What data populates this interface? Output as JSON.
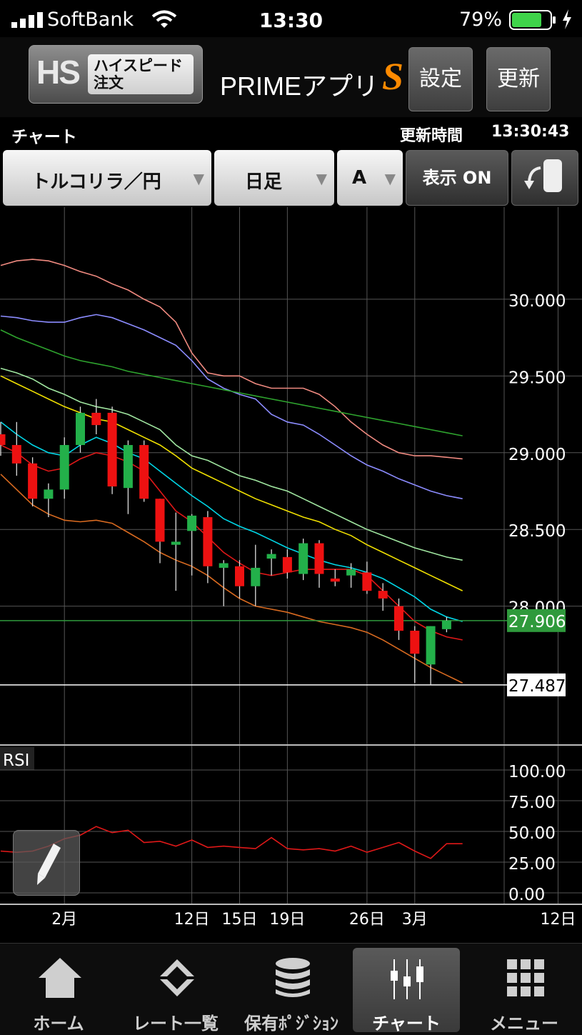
{
  "status_bar": {
    "carrier": "SoftBank",
    "time": "13:30",
    "battery_percent": "79%",
    "battery_level": 0.79
  },
  "header": {
    "hs_logo": "HS",
    "hs_label_line1": "ハイスピード",
    "hs_label_line2": "注文",
    "app_title": "PRIMEアプリ",
    "app_title_s": "S",
    "settings_label": "設定",
    "refresh_label": "更新"
  },
  "info": {
    "title": "チャート",
    "updated_label": "更新時間",
    "updated_time": "13:30:43"
  },
  "selectors": {
    "pair": "トルコリラ／円",
    "timeframe": "日足",
    "mode": "A",
    "display_toggle": "表示 ON"
  },
  "chart_data": {
    "type": "candlestick",
    "symbol": "トルコリラ／円",
    "y_ticks": [
      "30.000",
      "29.500",
      "29.000",
      "28.500",
      "28.000"
    ],
    "y_ticks_values": [
      30.0,
      29.5,
      29.0,
      28.5,
      28.0
    ],
    "ylim": [
      27.1,
      30.6
    ],
    "current_price": "27.906",
    "current_price_value": 27.906,
    "low_marker": "27.487",
    "low_marker_value": 27.487,
    "x_labels": [
      "2月",
      "12日",
      "15日",
      "19日",
      "26日",
      "3月",
      "12日"
    ],
    "x_label_index": [
      4,
      12,
      15,
      18,
      23,
      26,
      35
    ],
    "candles": [
      {
        "o": 29.12,
        "h": 29.2,
        "l": 28.98,
        "c": 29.05
      },
      {
        "o": 29.05,
        "h": 29.2,
        "l": 28.85,
        "c": 28.93
      },
      {
        "o": 28.93,
        "h": 28.97,
        "l": 28.65,
        "c": 28.7
      },
      {
        "o": 28.7,
        "h": 28.8,
        "l": 28.58,
        "c": 28.76
      },
      {
        "o": 28.76,
        "h": 29.1,
        "l": 28.7,
        "c": 29.05
      },
      {
        "o": 29.05,
        "h": 29.3,
        "l": 29.0,
        "c": 29.26
      },
      {
        "o": 29.26,
        "h": 29.35,
        "l": 29.12,
        "c": 29.18
      },
      {
        "o": 29.26,
        "h": 29.3,
        "l": 28.73,
        "c": 28.78
      },
      {
        "o": 28.77,
        "h": 29.08,
        "l": 28.6,
        "c": 29.05
      },
      {
        "o": 29.05,
        "h": 29.08,
        "l": 28.68,
        "c": 28.7
      },
      {
        "o": 28.7,
        "h": 28.7,
        "l": 28.28,
        "c": 28.42
      },
      {
        "o": 28.4,
        "h": 28.61,
        "l": 28.1,
        "c": 28.42
      },
      {
        "o": 28.49,
        "h": 28.6,
        "l": 28.2,
        "c": 28.59
      },
      {
        "o": 28.58,
        "h": 28.62,
        "l": 28.15,
        "c": 28.26
      },
      {
        "o": 28.25,
        "h": 28.3,
        "l": 28.0,
        "c": 28.28
      },
      {
        "o": 28.26,
        "h": 28.3,
        "l": 28.05,
        "c": 28.13
      },
      {
        "o": 28.13,
        "h": 28.4,
        "l": 28.0,
        "c": 28.25
      },
      {
        "o": 28.31,
        "h": 28.37,
        "l": 28.2,
        "c": 28.34
      },
      {
        "o": 28.32,
        "h": 28.37,
        "l": 28.18,
        "c": 28.22
      },
      {
        "o": 28.21,
        "h": 28.44,
        "l": 28.17,
        "c": 28.41
      },
      {
        "o": 28.41,
        "h": 28.43,
        "l": 28.12,
        "c": 28.21
      },
      {
        "o": 28.18,
        "h": 28.24,
        "l": 28.13,
        "c": 28.16
      },
      {
        "o": 28.2,
        "h": 28.28,
        "l": 28.12,
        "c": 28.24
      },
      {
        "o": 28.22,
        "h": 28.29,
        "l": 28.08,
        "c": 28.1
      },
      {
        "o": 28.1,
        "h": 28.15,
        "l": 27.97,
        "c": 28.05
      },
      {
        "o": 28.0,
        "h": 28.05,
        "l": 27.78,
        "c": 27.84
      },
      {
        "o": 27.84,
        "h": 27.87,
        "l": 27.5,
        "c": 27.69
      },
      {
        "o": 27.62,
        "h": 27.87,
        "l": 27.49,
        "c": 27.87
      },
      {
        "o": 27.85,
        "h": 27.93,
        "l": 27.83,
        "c": 27.906
      }
    ],
    "overlay_lines": [
      {
        "color": "#f08a80",
        "values": [
          30.22,
          30.25,
          30.26,
          30.25,
          30.22,
          30.18,
          30.15,
          30.1,
          30.06,
          30.0,
          29.95,
          29.85,
          29.65,
          29.52,
          29.5,
          29.5,
          29.45,
          29.42,
          29.42,
          29.42,
          29.38,
          29.3,
          29.2,
          29.12,
          29.05,
          29.0,
          28.98,
          28.98,
          28.97,
          28.96
        ]
      },
      {
        "color": "#8c8cff",
        "values": [
          29.89,
          29.88,
          29.86,
          29.85,
          29.85,
          29.88,
          29.9,
          29.88,
          29.84,
          29.8,
          29.75,
          29.7,
          29.6,
          29.48,
          29.42,
          29.38,
          29.35,
          29.25,
          29.2,
          29.18,
          29.12,
          29.05,
          28.98,
          28.92,
          28.88,
          28.83,
          28.79,
          28.75,
          28.72,
          28.7
        ]
      },
      {
        "color": "#2ea32e",
        "values": [
          29.8,
          29.75,
          29.71,
          29.67,
          29.63,
          29.6,
          29.58,
          29.56,
          29.53,
          29.51,
          29.49,
          29.47,
          29.45,
          29.43,
          29.41,
          29.39,
          29.37,
          29.35,
          29.33,
          29.31,
          29.29,
          29.27,
          29.25,
          29.23,
          29.21,
          29.19,
          29.17,
          29.15,
          29.13,
          29.11
        ]
      },
      {
        "color": "#a0e6a0",
        "values": [
          29.55,
          29.52,
          29.48,
          29.42,
          29.38,
          29.33,
          29.3,
          29.28,
          29.25,
          29.2,
          29.15,
          29.05,
          28.98,
          28.95,
          28.9,
          28.85,
          28.82,
          28.78,
          28.75,
          28.7,
          28.65,
          28.6,
          28.55,
          28.5,
          28.46,
          28.42,
          28.38,
          28.35,
          28.32,
          28.3
        ]
      },
      {
        "color": "#f0e000",
        "values": [
          29.5,
          29.45,
          29.4,
          29.35,
          29.3,
          29.26,
          29.22,
          29.2,
          29.15,
          29.1,
          29.05,
          28.98,
          28.9,
          28.85,
          28.8,
          28.75,
          28.7,
          28.66,
          28.62,
          28.58,
          28.55,
          28.5,
          28.46,
          28.4,
          28.35,
          28.3,
          28.25,
          28.2,
          28.15,
          28.1
        ]
      },
      {
        "color": "#00d6e6",
        "values": [
          29.2,
          29.12,
          29.05,
          29.0,
          28.98,
          29.05,
          29.1,
          29.06,
          29.0,
          28.96,
          28.88,
          28.8,
          28.72,
          28.65,
          28.57,
          28.52,
          28.48,
          28.43,
          28.38,
          28.34,
          28.3,
          28.27,
          28.25,
          28.22,
          28.18,
          28.12,
          28.06,
          27.98,
          27.93,
          27.9
        ]
      },
      {
        "color": "#e01818",
        "values": [
          29.05,
          29.0,
          28.92,
          28.88,
          28.9,
          28.96,
          29.0,
          28.98,
          28.94,
          28.88,
          28.75,
          28.62,
          28.55,
          28.45,
          28.35,
          28.28,
          28.22,
          28.2,
          28.22,
          28.24,
          28.24,
          28.24,
          28.24,
          28.2,
          28.1,
          28.0,
          27.9,
          27.84,
          27.8,
          27.78
        ]
      },
      {
        "color": "#d86a20",
        "values": [
          28.86,
          28.76,
          28.66,
          28.6,
          28.56,
          28.55,
          28.56,
          28.54,
          28.48,
          28.42,
          28.35,
          28.3,
          28.26,
          28.2,
          28.12,
          28.05,
          28.0,
          27.98,
          27.96,
          27.93,
          27.9,
          27.88,
          27.86,
          27.83,
          27.78,
          27.72,
          27.66,
          27.6,
          27.55,
          27.5
        ]
      }
    ],
    "rsi": {
      "label": "RSI",
      "y_ticks": [
        "100.00",
        "75.00",
        "50.00",
        "25.00",
        "0.00"
      ],
      "y_ticks_values": [
        100,
        75,
        50,
        25,
        0
      ],
      "ylim": [
        0,
        100
      ],
      "values": [
        34,
        33,
        34,
        38,
        44,
        47,
        54,
        49,
        51,
        41,
        42,
        38,
        43,
        37,
        38,
        37,
        36,
        45,
        36,
        35,
        36,
        34,
        38,
        33,
        37,
        41,
        34,
        28,
        40,
        40
      ]
    }
  },
  "bottom_nav": [
    {
      "label": "ホーム",
      "icon": "home-icon"
    },
    {
      "label": "レート一覧",
      "icon": "rate-list-icon"
    },
    {
      "label": "保有ﾎﾟｼﾞｼｮﾝ",
      "icon": "positions-icon"
    },
    {
      "label": "チャート",
      "icon": "chart-icon",
      "active": true
    },
    {
      "label": "メニュー",
      "icon": "menu-grid-icon"
    }
  ],
  "colors": {
    "up_candle": "#23b04a",
    "down_candle": "#ee1111",
    "price_tag": "#2f9a3c",
    "accent": "#ff8a00",
    "rsi_line": "#e01818"
  }
}
